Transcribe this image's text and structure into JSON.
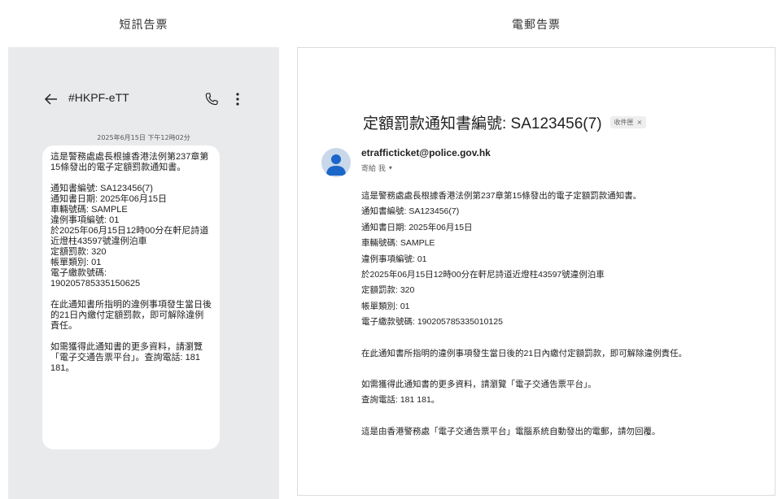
{
  "sms": {
    "column_title": "短訊告票",
    "contact": "#HKPF-eTT",
    "timestamp": "2025年6月15日 下午12時02分",
    "paragraphs": [
      "這是警務處處長根據香港法例第237章第15條發出的電子定額罰款通知書。",
      "通知書編號: SA123456(7)\n通知書日期: 2025年06月15日\n車輛號碼: SAMPLE\n違例事項編號: 01\n於2025年06月15日12時00分在軒尼詩道近燈柱43597號違例泊車\n定額罰款: 320\n帳單類別: 01\n電子繳款號碼:\n190205785335150625",
      "在此通知書所指明的違例事項發生當日後的21日內繳付定額罰款，即可解除違例責任。",
      "如需獲得此通知書的更多資料，請瀏覽「電子交通告票平台」。查詢電話: 181 181。"
    ]
  },
  "email": {
    "column_title": "電郵告票",
    "subject": "定額罰款通知書編號: SA123456(7)",
    "inbox_label": "收件匣",
    "inbox_close": "×",
    "sender": "etrafficticket@police.gov.hk",
    "recipient": "寄給 我",
    "recipient_caret": "▾",
    "paragraphs": [
      "這是警務處處長根據香港法例第237章第15條發出的電子定額罰款通知書。\n通知書編號: SA123456(7)\n通知書日期: 2025年06月15日\n車輛號碼: SAMPLE\n違例事項編號: 01\n於2025年06月15日12時00分在軒尼詩道近燈柱43597號違例泊車\n定額罰款: 320\n帳單類別: 01\n電子繳款號碼: 190205785335010125",
      "在此通知書所指明的違例事項發生當日後的21日內繳付定額罰款，即可解除違例責任。",
      "如需獲得此通知書的更多資料，請瀏覽「電子交通告票平台」。\n查詢電話: 181 181。",
      "這是由香港警務處「電子交通告票平台」電腦系統自動發出的電郵，請勿回覆。"
    ]
  },
  "icons": {
    "back": "arrow-left-icon",
    "phone": "phone-icon",
    "more": "more-vertical-icon",
    "avatar": "person-avatar-icon"
  },
  "colors": {
    "sms_background": "#e8eaec",
    "avatar_background": "#c9d7ea",
    "avatar_figure": "#1a66c9"
  }
}
